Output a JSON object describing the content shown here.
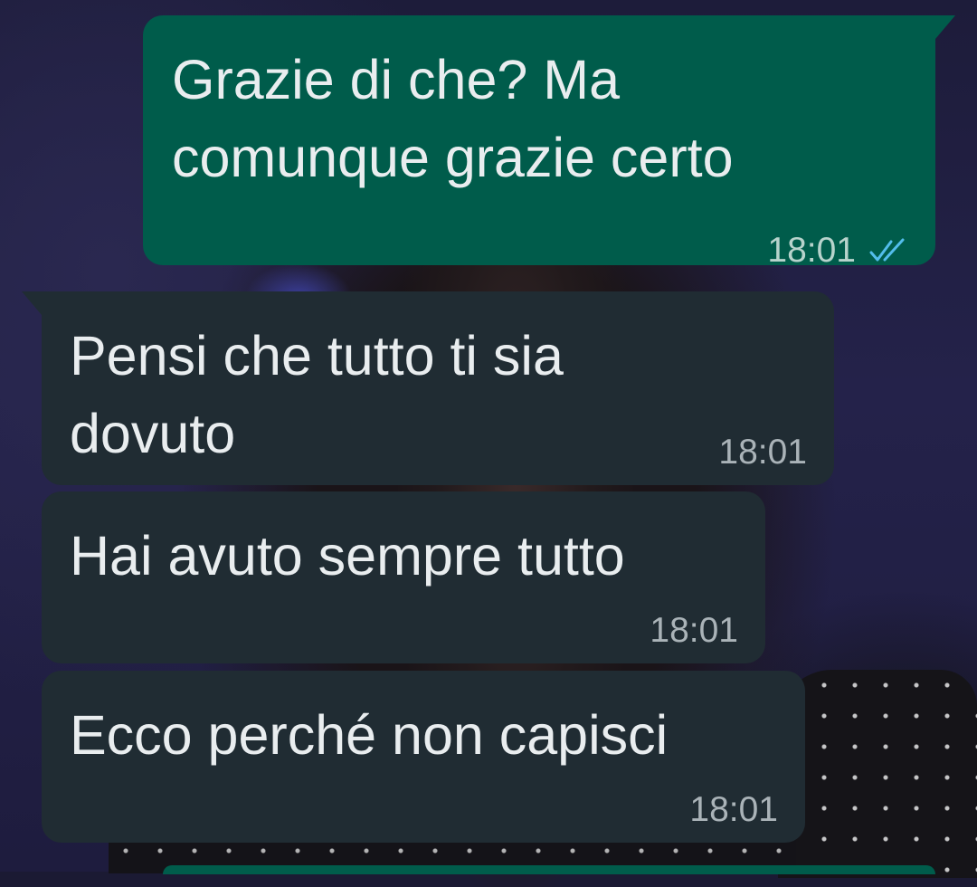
{
  "conversation": {
    "messages": [
      {
        "direction": "outgoing",
        "text": "Grazie di che? Ma\ncomunque grazie certo",
        "time": "18:01",
        "status_icon": "double-check-icon"
      },
      {
        "direction": "incoming",
        "text": "Pensi che tutto ti sia\ndovuto",
        "time": "18:01"
      },
      {
        "direction": "incoming",
        "text": "Hai avuto sempre tutto",
        "time": "18:01"
      },
      {
        "direction": "incoming",
        "text": "Ecco perché non capisci",
        "time": "18:01"
      }
    ]
  },
  "colors": {
    "outgoing_bubble": "#005c4b",
    "incoming_bubble": "#202c33",
    "read_ticks": "#53bdeb",
    "message_text": "#e9edef"
  }
}
